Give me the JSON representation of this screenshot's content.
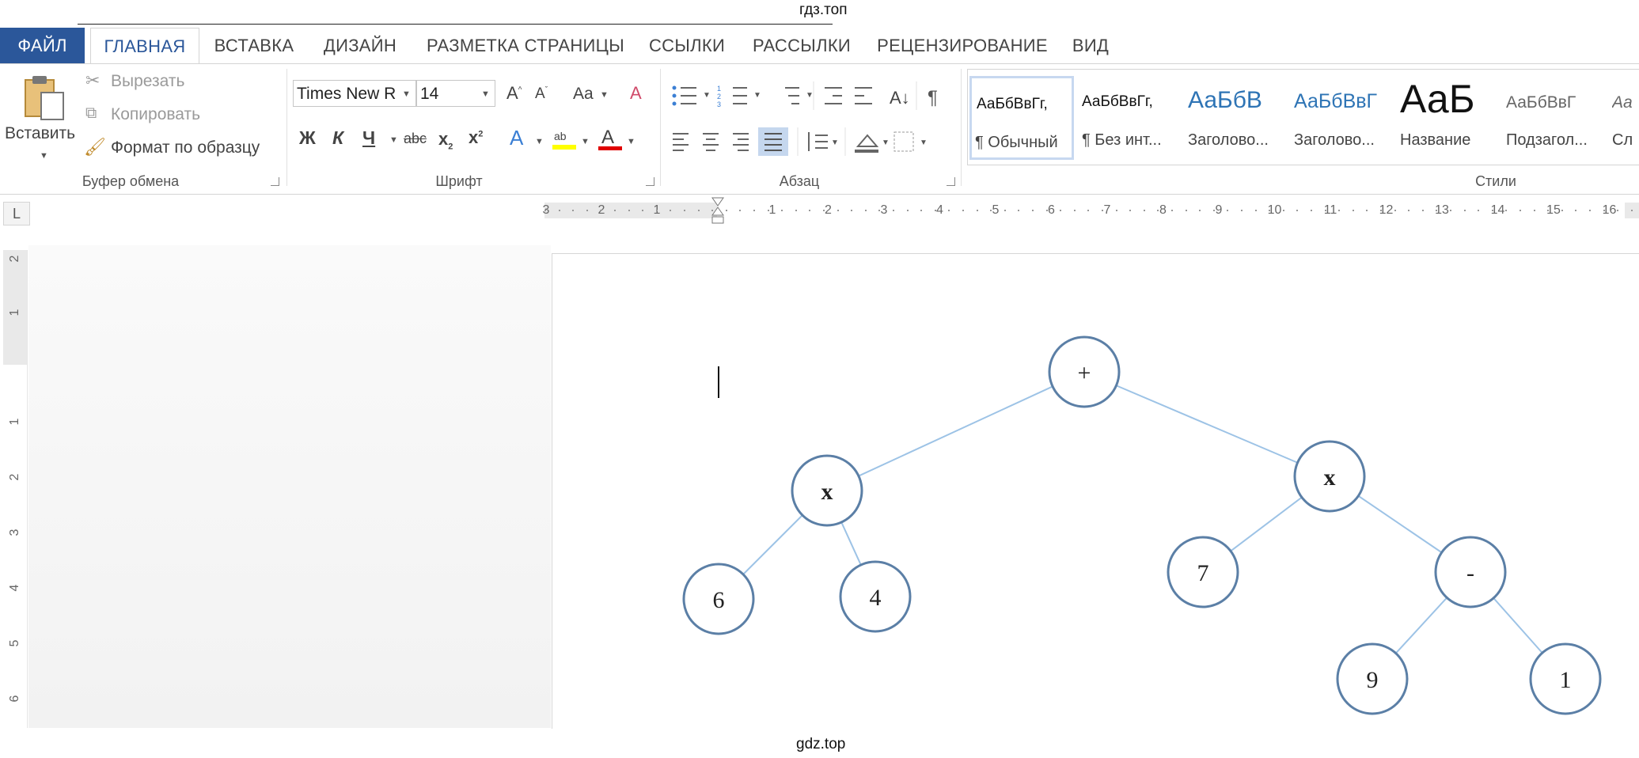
{
  "watermark": {
    "top": "гдз.топ",
    "bottom": "gdz.top"
  },
  "tabs": [
    {
      "label": "ФАЙЛ"
    },
    {
      "label": "ГЛАВНАЯ"
    },
    {
      "label": "ВСТАВКА"
    },
    {
      "label": "ДИЗАЙН"
    },
    {
      "label": "РАЗМЕТКА СТРАНИЦЫ"
    },
    {
      "label": "ССЫЛКИ"
    },
    {
      "label": "РАССЫЛКИ"
    },
    {
      "label": "РЕЦЕНЗИРОВАНИЕ"
    },
    {
      "label": "ВИД"
    }
  ],
  "clipboard": {
    "paste": "Вставить",
    "cut": "Вырезать",
    "copy": "Копировать",
    "format_painter": "Формат по образцу",
    "group": "Буфер обмена"
  },
  "font": {
    "name": "Times New R",
    "size": "14",
    "group": "Шрифт",
    "bold": "Ж",
    "italic": "К",
    "underline": "Ч",
    "strike": "abc",
    "change_case": "Aa"
  },
  "paragraph": {
    "group": "Абзац"
  },
  "styles": {
    "group": "Стили",
    "items": [
      {
        "sample": "АаБбВвГг,",
        "name": "¶ Обычный"
      },
      {
        "sample": "АаБбВвГг,",
        "name": "¶ Без инт..."
      },
      {
        "sample": "АаБбВ",
        "name": "Заголово..."
      },
      {
        "sample": "АаБбВвГ",
        "name": "Заголово..."
      },
      {
        "sample": "АаБ",
        "name": "Название"
      },
      {
        "sample": "АаБбВвГ",
        "name": "Подзагол..."
      },
      {
        "sample": "Аа",
        "name": "Сл"
      }
    ]
  },
  "ruler": {
    "left_numbers": [
      "3",
      "2",
      "1"
    ],
    "right_numbers": [
      "1",
      "2",
      "3",
      "4",
      "5",
      "6",
      "7",
      "8",
      "9",
      "10",
      "11",
      "12",
      "13",
      "14",
      "15",
      "16"
    ],
    "vertical_numbers": [
      "2",
      "1",
      "1",
      "2",
      "3",
      "4",
      "5",
      "6"
    ]
  },
  "ruler_corner": "L",
  "tree": {
    "nodes": [
      {
        "id": "root",
        "label": "+"
      },
      {
        "id": "lmul",
        "label": "x"
      },
      {
        "id": "rmul",
        "label": "x"
      },
      {
        "id": "n6",
        "label": "6"
      },
      {
        "id": "n4",
        "label": "4"
      },
      {
        "id": "n7",
        "label": "7"
      },
      {
        "id": "minus",
        "label": "-"
      },
      {
        "id": "n9",
        "label": "9"
      },
      {
        "id": "n1",
        "label": "1"
      }
    ],
    "edges": [
      [
        "root",
        "lmul"
      ],
      [
        "root",
        "rmul"
      ],
      [
        "lmul",
        "n6"
      ],
      [
        "lmul",
        "n4"
      ],
      [
        "rmul",
        "n7"
      ],
      [
        "rmul",
        "minus"
      ],
      [
        "minus",
        "n9"
      ],
      [
        "minus",
        "n1"
      ]
    ],
    "colors": {
      "edge": "#9dc3e6",
      "node_border": "#5b7fa6"
    }
  }
}
